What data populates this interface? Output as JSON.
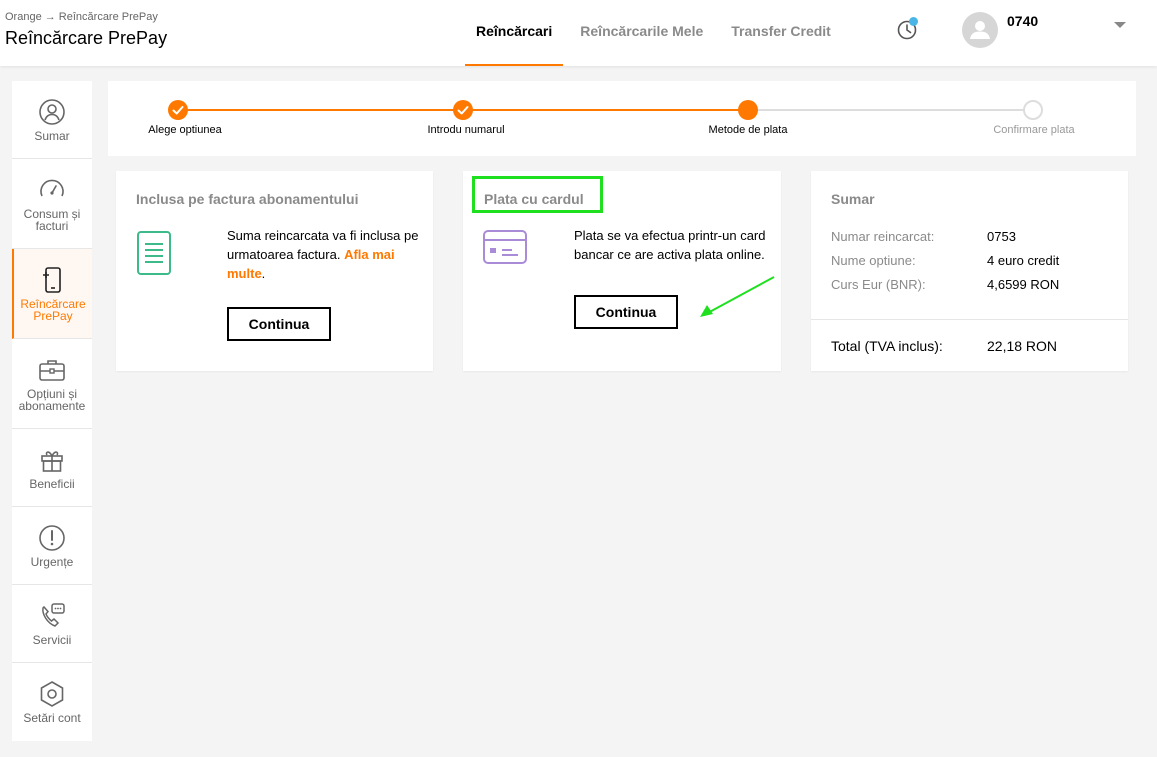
{
  "header": {
    "breadcrumb": "Orange → Reîncărcare PrePay",
    "title": "Reîncărcare PrePay",
    "tabs": [
      {
        "label": "Reîncărcari",
        "active": true
      },
      {
        "label": "Reîncărcarile Mele",
        "active": false
      },
      {
        "label": "Transfer Credit",
        "active": false
      }
    ],
    "user_number": "0740",
    "icons": {
      "history": "history-icon",
      "avatar": "user-avatar-icon",
      "dropdown": "caret-down-icon"
    }
  },
  "sidebar": {
    "items": [
      {
        "label": "Sumar",
        "icon": "user-circle-icon",
        "active": false
      },
      {
        "label": "Consum și facturi",
        "icon": "gauge-icon",
        "active": false
      },
      {
        "label": "Reîncărcare PrePay",
        "icon": "phone-recharge-icon",
        "active": true
      },
      {
        "label": "Opțiuni și abonamente",
        "icon": "briefcase-icon",
        "active": false
      },
      {
        "label": "Beneficii",
        "icon": "gift-icon",
        "active": false
      },
      {
        "label": "Urgențe",
        "icon": "alert-circle-icon",
        "active": false
      },
      {
        "label": "Servicii",
        "icon": "phone-chat-icon",
        "active": false
      },
      {
        "label": "Setări cont",
        "icon": "settings-hexagon-icon",
        "active": false
      }
    ]
  },
  "stepper": {
    "steps": [
      {
        "label": "Alege optiunea",
        "state": "done"
      },
      {
        "label": "Introdu numarul",
        "state": "done"
      },
      {
        "label": "Metode de plata",
        "state": "current"
      },
      {
        "label": "Confirmare plata",
        "state": "pending"
      }
    ]
  },
  "payment_options": {
    "invoice": {
      "title": "Inclusa pe factura abonamentului",
      "text": "Suma reincarcata va fi inclusa pe urmatoarea factura.",
      "link": "Afla mai multe",
      "text_end": ".",
      "button": "Continua",
      "icon": "document-icon"
    },
    "card": {
      "title": "Plata cu cardul",
      "text": "Plata se va efectua printr-un card bancar ce are activa plata online.",
      "button": "Continua",
      "icon": "credit-card-icon"
    }
  },
  "summary": {
    "title": "Sumar",
    "rows": [
      {
        "label": "Numar reincarcat:",
        "value": "0753"
      },
      {
        "label": "Nume optiune:",
        "value": "4 euro credit"
      },
      {
        "label": "Curs Eur (BNR):",
        "value": "4,6599 RON"
      }
    ],
    "total_label": "Total (TVA inclus):",
    "total_value": "22,18 RON"
  },
  "colors": {
    "accent": "#ff7900",
    "highlight": "#1fe01f",
    "doc_icon": "#3dba8a",
    "card_icon": "#a98bd8",
    "notification": "#4bb4e6"
  }
}
